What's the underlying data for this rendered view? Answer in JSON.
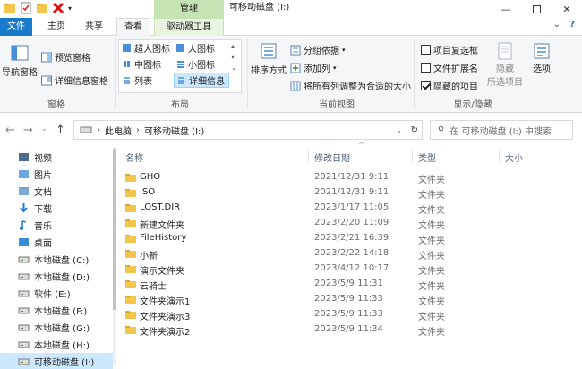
{
  "window": {
    "title": "可移动磁盘 (I:)",
    "context_tab_group": "管理"
  },
  "tabs": {
    "file": "文件",
    "home": "主页",
    "share": "共享",
    "view": "查看",
    "drive_tools": "驱动器工具"
  },
  "ribbon": {
    "panes": {
      "nav_pane": "导航窗格",
      "preview_pane": "预览窗格",
      "details_pane": "详细信息窗格",
      "label": "窗格"
    },
    "layout": {
      "xl_icons": "超大图标",
      "large_icons": "大图标",
      "medium_icons": "中图标",
      "small_icons": "小图标",
      "list": "列表",
      "details": "详细信息",
      "label": "布局"
    },
    "current_view": {
      "sort_by": "排序方式",
      "group_by": "分组依据",
      "add_column": "添加列",
      "fit_columns": "将所有列调整为合适的大小",
      "label": "当前视图"
    },
    "show_hide": {
      "item_checkboxes": "项目复选框",
      "file_ext": "文件扩展名",
      "hidden_items": "隐藏的项目",
      "hide": "隐藏",
      "hide_selected": "所选项目",
      "options": "选项",
      "label": "显示/隐藏",
      "item_checkboxes_checked": false,
      "file_ext_checked": false,
      "hidden_items_checked": true
    }
  },
  "address": {
    "this_pc": "此电脑",
    "current": "可移动磁盘 (I:)",
    "search_placeholder": "在 可移动磁盘 (I:) 中搜索"
  },
  "nav": [
    "视频",
    "图片",
    "文档",
    "下载",
    "音乐",
    "桌面",
    "本地磁盘 (C:)",
    "本地磁盘 (D:)",
    "软件 (E:)",
    "本地磁盘 (F:)",
    "本地磁盘 (G:)",
    "本地磁盘 (H:)",
    "可移动磁盘 (I:)"
  ],
  "columns": {
    "name": "名称",
    "date": "修改日期",
    "type": "类型",
    "size": "大小"
  },
  "files": [
    {
      "name": "GHO",
      "date": "2021/12/31 9:11",
      "type": "文件夹"
    },
    {
      "name": "ISO",
      "date": "2021/12/31 9:11",
      "type": "文件夹"
    },
    {
      "name": "LOST.DIR",
      "date": "2023/1/17 11:05",
      "type": "文件夹"
    },
    {
      "name": "新建文件夹",
      "date": "2023/2/20 11:09",
      "type": "文件夹"
    },
    {
      "name": "FileHistory",
      "date": "2023/2/21 16:39",
      "type": "文件夹"
    },
    {
      "name": "小新",
      "date": "2023/2/22 14:18",
      "type": "文件夹"
    },
    {
      "name": "演示文件夹",
      "date": "2023/4/12 10:17",
      "type": "文件夹"
    },
    {
      "name": "云骑士",
      "date": "2023/5/9 11:31",
      "type": "文件夹"
    },
    {
      "name": "文件夹演示1",
      "date": "2023/5/9 11:33",
      "type": "文件夹"
    },
    {
      "name": "文件夹演示3",
      "date": "2023/5/9 11:33",
      "type": "文件夹"
    },
    {
      "name": "文件夹演示2",
      "date": "2023/5/9 11:34",
      "type": "文件夹"
    }
  ],
  "colors": {
    "accent": "#1979ca",
    "folder": "#f3c54d",
    "context_tab": "#c5e3b3"
  }
}
